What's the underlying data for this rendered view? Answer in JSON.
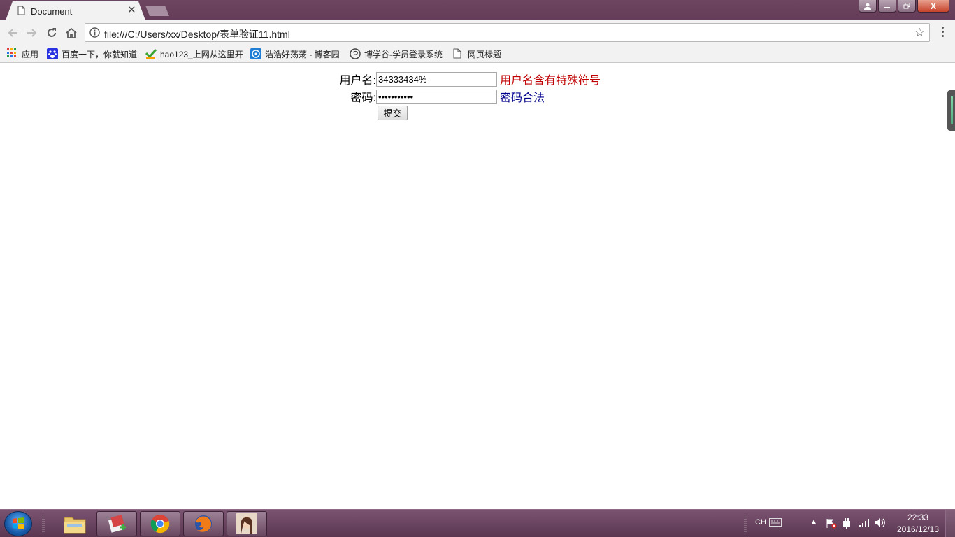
{
  "browser": {
    "tab_title": "Document",
    "url": "file:///C:/Users/xx/Desktop/表单验证11.html"
  },
  "bookmarks": [
    {
      "label": "应用",
      "icon": "apps-grid-icon"
    },
    {
      "label": "百度一下，你就知道",
      "icon": "baidu-paw-icon"
    },
    {
      "label": "hao123_上网从这里开",
      "icon": "hao123-icon"
    },
    {
      "label": "浩浩好荡荡 - 博客园",
      "icon": "cnblogs-icon"
    },
    {
      "label": "博学谷-学员登录系统",
      "icon": "boxuegu-icon"
    },
    {
      "label": "网页标题",
      "icon": "page-icon"
    }
  ],
  "form": {
    "username_label": "用户名:",
    "username_value": "34333434%",
    "username_message": "用户名含有特殊符号",
    "password_label": "密码:",
    "password_value": "•••••••••••",
    "password_message": "密码合法",
    "submit_label": "提交"
  },
  "taskbar": {
    "lang": "CH",
    "time": "22:33",
    "date": "2016/12/13"
  },
  "colors": {
    "error_message": "#c00000",
    "ok_message": "#00008b",
    "titlebar": "#643c57"
  }
}
